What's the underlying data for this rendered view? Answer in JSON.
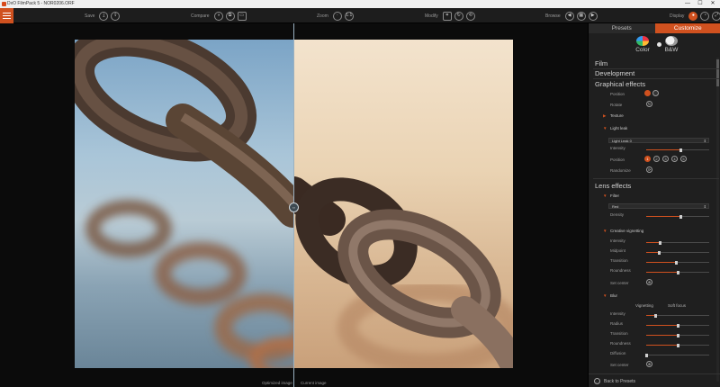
{
  "window": {
    "title": "DxO FilmPack 5 - NOR0206.ORF",
    "controls": {
      "minimize": "—",
      "maximize": "☐",
      "close": "✕"
    }
  },
  "toolbar": {
    "save": {
      "label": "Save"
    },
    "compare": {
      "label": "Compare"
    },
    "zoom": {
      "label": "Zoom"
    },
    "modify": {
      "label": "Modify"
    },
    "browse": {
      "label": "Browse"
    },
    "display": {
      "label": "Display"
    }
  },
  "viewer": {
    "left_caption": "Optimized image",
    "right_caption": "Current image",
    "split_position": 0.5
  },
  "panel": {
    "tabs": [
      {
        "label": "Presets"
      },
      {
        "label": "Customize"
      }
    ],
    "modes": {
      "color": "Color",
      "bw": "B&W"
    },
    "sections": {
      "film": "Film",
      "development": "Development",
      "graphical": "Graphical effects",
      "lens": "Lens effects"
    },
    "graphical": {
      "position_label": "Position",
      "rotate_label": "Rotate",
      "texture_label": "Texture",
      "light_leak_label": "Light leak",
      "light_leak_select": "Light Leak 0",
      "intensity_label": "Intensity",
      "intensity_value": 0.55,
      "position2_label": "Position",
      "randomize_label": "Randomize"
    },
    "lens": {
      "filter_label": "Filter",
      "filter_select": "Red",
      "density_label": "Density",
      "density_value": 0.55,
      "vignetting_label": "Creative vignetting",
      "vig_intensity_label": "Intensity",
      "vig_intensity_value": 0.22,
      "vig_midpoint_label": "Midpoint",
      "vig_midpoint_value": 0.2,
      "vig_transition_label": "Transition",
      "vig_transition_value": 0.48,
      "vig_roundness_label": "Roundness",
      "vig_roundness_value": 0.5,
      "vig_setcenter_label": "Set center",
      "blur_label": "Blur",
      "blur_tabs": {
        "vignetting": "Vignetting",
        "soft_focus": "Soft focus"
      },
      "blur_intensity_label": "Intensity",
      "blur_intensity_value": 0.15,
      "blur_radius_label": "Radius",
      "blur_radius_value": 0.5,
      "blur_transition_label": "Transition",
      "blur_transition_value": 0.5,
      "blur_roundness_label": "Roundness",
      "blur_roundness_value": 0.5,
      "blur_diffusion_label": "Diffusion",
      "blur_diffusion_value": 0.0,
      "blur_setcenter_label": "Set center"
    },
    "back_label": "Back to Presets"
  },
  "colors": {
    "accent": "#d0511f",
    "panel": "#1f1f1f",
    "toolbar": "#1d1d1d"
  }
}
